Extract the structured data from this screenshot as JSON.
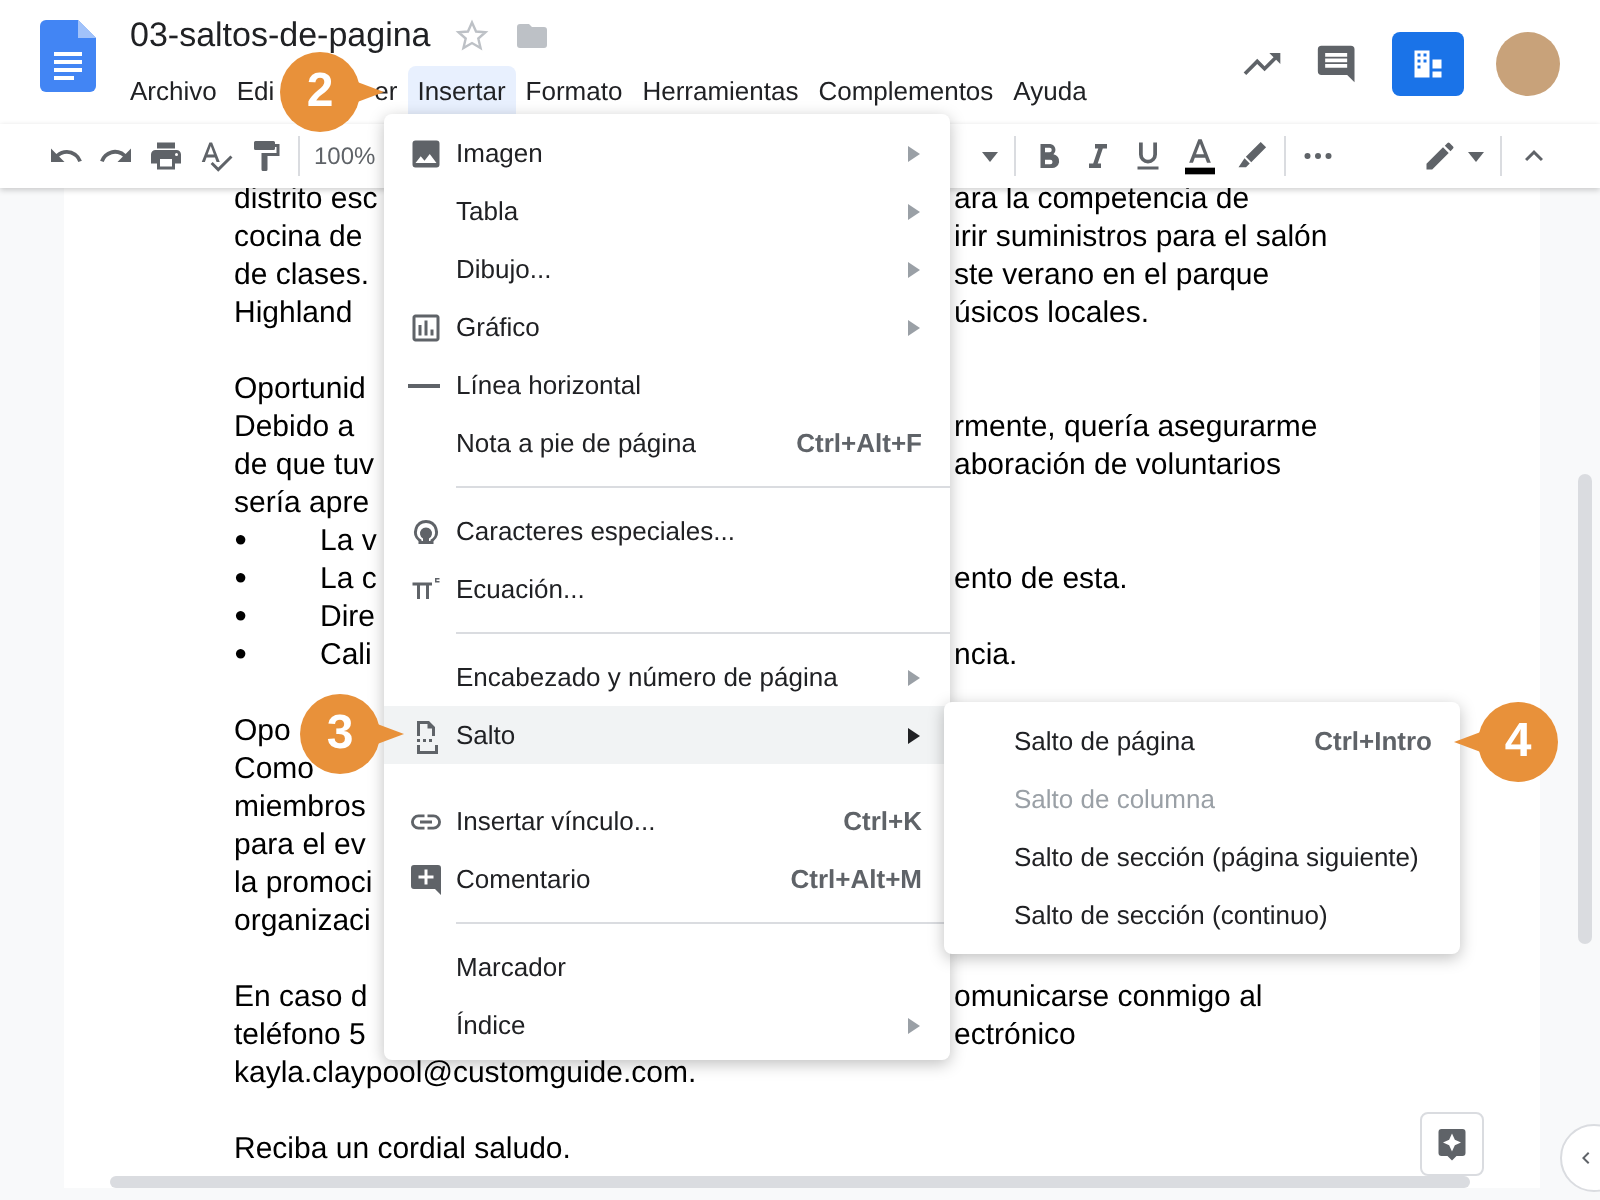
{
  "document_title": "03-saltos-de-pagina",
  "menu_bar": [
    {
      "label": "Archivo",
      "selected": false
    },
    {
      "label": "Edi",
      "selected": false
    },
    {
      "label": "er",
      "selected": false
    },
    {
      "label": "Insertar",
      "selected": true
    },
    {
      "label": "Formato",
      "selected": false
    },
    {
      "label": "Herramientas",
      "selected": false
    },
    {
      "label": "Complementos",
      "selected": false
    },
    {
      "label": "Ayuda",
      "selected": false
    }
  ],
  "toolbar": {
    "zoom": "100%"
  },
  "document_lines": [
    {
      "kind": "text",
      "left": "distrito esc",
      "right": "ara la competencia de"
    },
    {
      "kind": "text",
      "left": "cocina de",
      "right": "irir suministros para el salón"
    },
    {
      "kind": "text",
      "left": "de clases.",
      "right": "ste verano en el parque"
    },
    {
      "kind": "text",
      "left": "Highland",
      "right": "úsicos locales."
    },
    {
      "kind": "blank"
    },
    {
      "kind": "text",
      "left": "Oportunid"
    },
    {
      "kind": "text",
      "left": "Debido a",
      "right": "rmente, quería asegurarme"
    },
    {
      "kind": "text",
      "left": "de que tuv",
      "right": "aboración de voluntarios"
    },
    {
      "kind": "text",
      "left": "sería apre"
    },
    {
      "kind": "bullet",
      "marker": "●",
      "left": "La v"
    },
    {
      "kind": "bullet",
      "marker": "●",
      "left": "La c",
      "right": "ento de esta."
    },
    {
      "kind": "bullet",
      "marker": "●",
      "left": "Dire"
    },
    {
      "kind": "bullet",
      "marker": "●",
      "left": "Cali",
      "right": "ncia."
    },
    {
      "kind": "blank"
    },
    {
      "kind": "text",
      "left": "Opo"
    },
    {
      "kind": "text",
      "left": "Como"
    },
    {
      "kind": "text",
      "left": "miembros"
    },
    {
      "kind": "text",
      "left": "para el ev"
    },
    {
      "kind": "text",
      "left": "la promoci"
    },
    {
      "kind": "text",
      "left": "organizaci"
    },
    {
      "kind": "blank"
    },
    {
      "kind": "text",
      "left": "En caso d",
      "right": "omunicarse conmigo al"
    },
    {
      "kind": "text",
      "left": "teléfono 5",
      "right": "ectrónico"
    },
    {
      "kind": "text",
      "left": "kayla.claypool@customguide.com."
    },
    {
      "kind": "blank"
    },
    {
      "kind": "text",
      "left": "Reciba un cordial saludo."
    }
  ],
  "insert_menu": [
    {
      "kind": "item",
      "label": "Imagen",
      "submenu": true,
      "selected": false
    },
    {
      "kind": "item",
      "label": "Tabla",
      "submenu": true,
      "selected": false
    },
    {
      "kind": "item",
      "label": "Dibujo...",
      "submenu": true,
      "selected": false
    },
    {
      "kind": "item",
      "label": "Gráfico",
      "submenu": true,
      "selected": false
    },
    {
      "kind": "item",
      "label": "Línea horizontal",
      "submenu": false,
      "selected": false
    },
    {
      "kind": "item",
      "label": "Nota a pie de página",
      "shortcut": "Ctrl+Alt+F",
      "submenu": false,
      "selected": false
    },
    {
      "kind": "divider"
    },
    {
      "kind": "item",
      "label": "Caracteres especiales...",
      "submenu": false,
      "selected": false
    },
    {
      "kind": "item",
      "label": "Ecuación...",
      "submenu": false,
      "selected": false
    },
    {
      "kind": "divider"
    },
    {
      "kind": "item",
      "label": "Encabezado y número de página",
      "submenu": true,
      "selected": false
    },
    {
      "kind": "item",
      "label": "Salto",
      "submenu": true,
      "selected": true
    },
    {
      "kind": "item",
      "label": "Insertar vínculo...",
      "shortcut": "Ctrl+K",
      "submenu": false,
      "selected": false
    },
    {
      "kind": "item",
      "label": "Comentario",
      "shortcut": "Ctrl+Alt+M",
      "submenu": false,
      "selected": false
    },
    {
      "kind": "divider"
    },
    {
      "kind": "item",
      "label": "Marcador",
      "submenu": false,
      "selected": false
    },
    {
      "kind": "item",
      "label": "Índice",
      "submenu": true,
      "selected": false
    }
  ],
  "break_submenu": [
    {
      "label": "Salto de página",
      "shortcut": "Ctrl+Intro",
      "disabled": false
    },
    {
      "label": "Salto de columna",
      "disabled": true
    },
    {
      "label": "Salto de sección (página siguiente)",
      "disabled": false
    },
    {
      "label": "Salto de sección (continuo)",
      "disabled": false
    }
  ],
  "callouts": [
    {
      "number": "2"
    },
    {
      "number": "3"
    },
    {
      "number": "4"
    }
  ]
}
